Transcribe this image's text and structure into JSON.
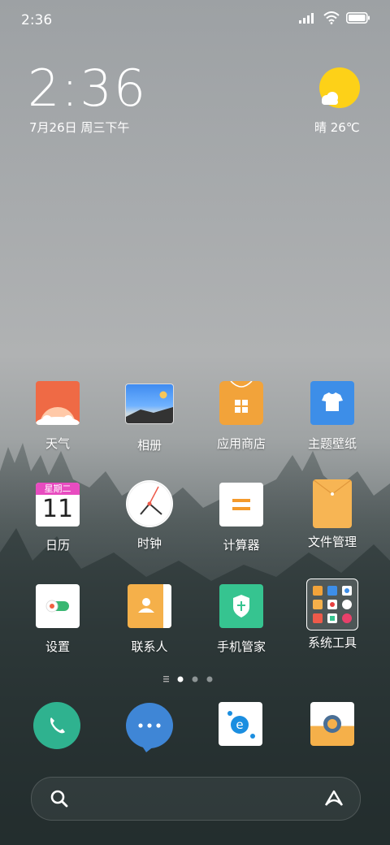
{
  "status_bar": {
    "time": "2:36"
  },
  "clock_widget": {
    "time": "2:36",
    "date": "7月26日 周三下午"
  },
  "weather_widget": {
    "text": "晴 26℃"
  },
  "apps": [
    {
      "label": "天气"
    },
    {
      "label": "相册"
    },
    {
      "label": "应用商店"
    },
    {
      "label": "主题壁纸"
    },
    {
      "label": "日历"
    },
    {
      "label": "时钟"
    },
    {
      "label": "计算器"
    },
    {
      "label": "文件管理"
    },
    {
      "label": "设置"
    },
    {
      "label": "联系人"
    },
    {
      "label": "手机管家"
    },
    {
      "label": "系统工具"
    }
  ],
  "calendar_icon": {
    "weekday": "星期二",
    "day": "11"
  },
  "page_indicator": {
    "pages": 3,
    "current": 1
  },
  "dock": {
    "items": [
      "phone-icon",
      "messages-icon",
      "browser-icon",
      "camera-icon"
    ]
  },
  "colors": {
    "weather_orange": "#ef6a45",
    "store_orange": "#f2a33a",
    "theme_blue": "#3d8ee8",
    "security_green": "#36c490",
    "phone_green": "#2fb28f",
    "message_blue": "#3f86d6",
    "calendar_pink": "#e84cc0"
  }
}
